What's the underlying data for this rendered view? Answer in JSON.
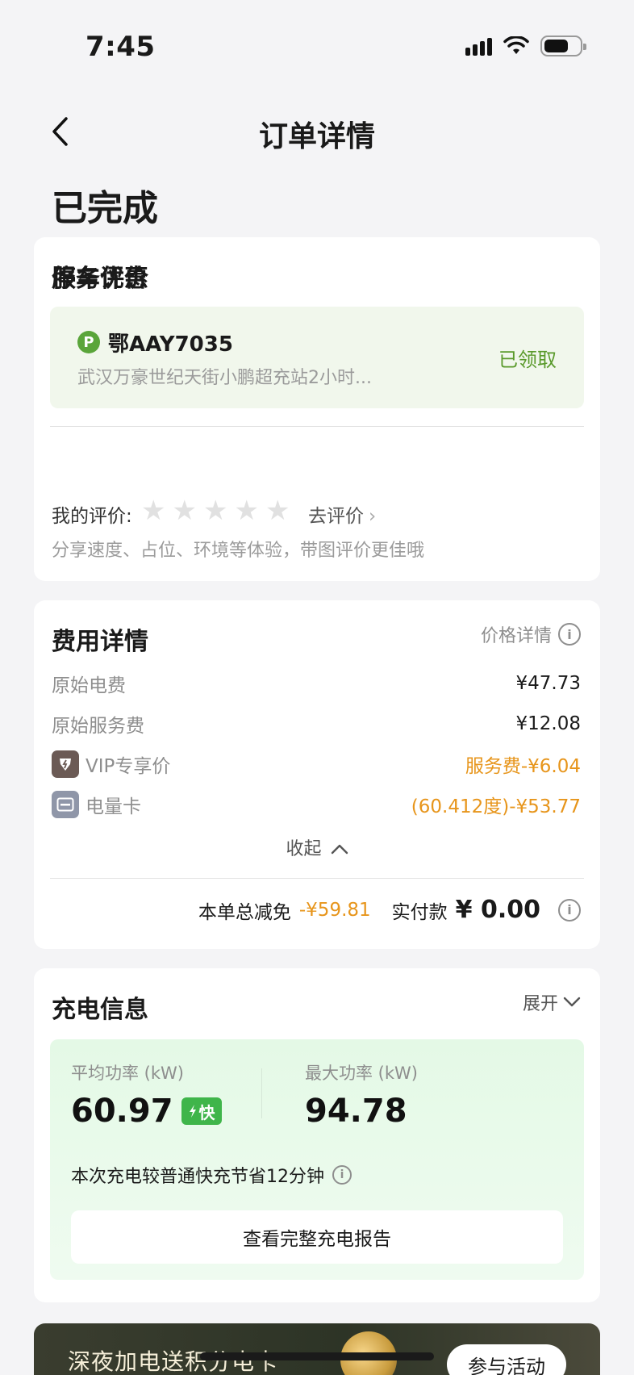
{
  "status_bar": {
    "time": "7:45"
  },
  "nav": {
    "title": "订单详情"
  },
  "order_status": "已完成",
  "parking": {
    "title": "停车优惠",
    "plate_icon": "P",
    "plate": "鄂AAY7035",
    "desc": "武汉万豪世纪天街小鹏超充站2小时...",
    "status": "已领取"
  },
  "review": {
    "title": "服务评价",
    "my_label": "我的评价:",
    "stars": [
      "★",
      "★",
      "★",
      "★",
      "★"
    ],
    "go_review": "去评价",
    "hint": "分享速度、占位、环境等体验，带图评价更佳哦"
  },
  "fees": {
    "title": "费用详情",
    "price_detail": "价格详情",
    "rows": [
      {
        "label": "原始电费",
        "value": "¥47.73"
      },
      {
        "label": "原始服务费",
        "value": "¥12.08"
      },
      {
        "label": "VIP专享价",
        "value": "服务费-¥6.04"
      },
      {
        "label": "电量卡",
        "value": "(60.412度)-¥53.77"
      }
    ],
    "collapse": "收起",
    "total_label": "本单总减免",
    "total_discount": "-¥59.81",
    "paid_label": "实付款",
    "paid_value": "¥ 0.00"
  },
  "charging": {
    "title": "充电信息",
    "expand": "展开",
    "avg_label": "平均功率 (kW)",
    "avg_value": "60.97",
    "fast_badge": "快",
    "max_label": "最大功率 (kW)",
    "max_value": "94.78",
    "saved_note": "本次充电较普通快充节省12分钟",
    "report_btn": "查看完整充电报告"
  },
  "promo": {
    "text": "深夜加电送积分电卡",
    "button": "参与活动"
  },
  "colors": {
    "accent_green": "#5aa53a",
    "orange": "#e7951b",
    "fast_green": "#3fb54a"
  }
}
